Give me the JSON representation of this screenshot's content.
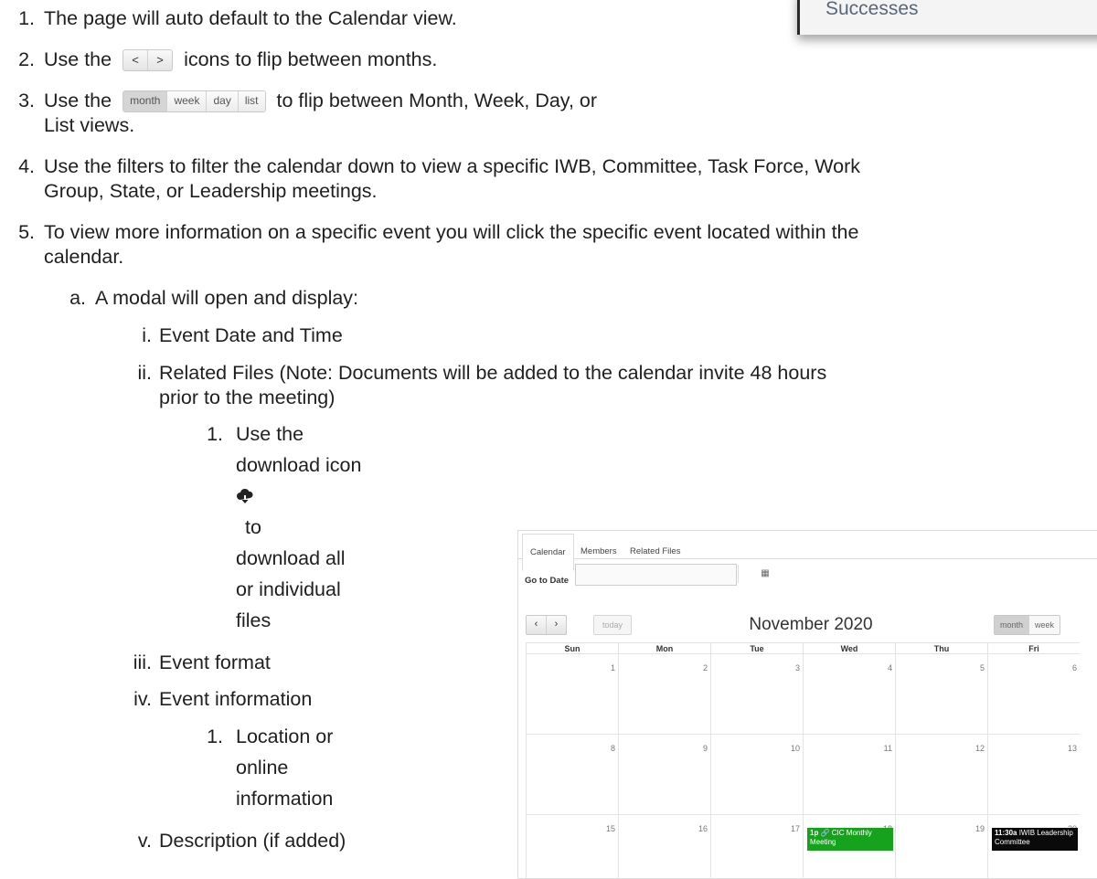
{
  "successes_label": "Successes",
  "steps": [
    {
      "num": "1.",
      "text": "The page will auto default to the Calendar view."
    },
    {
      "num": "2.",
      "pre": "Use the",
      "nav_prev": "<",
      "nav_next": ">",
      "post": "icons to flip between months."
    },
    {
      "num": "3.",
      "pre": "Use the",
      "views": [
        "month",
        "week",
        "day",
        "list"
      ],
      "post": "to flip between Month, Week, Day, or",
      "cont": "List views."
    },
    {
      "num": "4.",
      "text": "Use the filters to filter the calendar down to view a specific IWB, Committee, Task Force, Work",
      "cont": "Group, State, or Leadership meetings."
    },
    {
      "num": "5.",
      "text": "To view more information on a specific event you will click the specific event located within the",
      "cont": "calendar."
    }
  ],
  "sub_a": {
    "num": "a.",
    "text": "A modal will open and display:"
  },
  "roman": [
    {
      "num": "i.",
      "text": "Event Date and Time"
    },
    {
      "num": "ii.",
      "text": "Related Files (Note: Documents will be added to the calendar invite 48 hours",
      "cont": "prior to the meeting)"
    },
    {
      "num": "iii.",
      "text": "Event format"
    },
    {
      "num": "iv.",
      "text": "Event information"
    },
    {
      "num": "v.",
      "text": "Description (if added)"
    }
  ],
  "download_item": {
    "num": "1.",
    "lines": [
      "Use the",
      "download icon",
      "to",
      "download all",
      "or individual",
      "files"
    ],
    "icon": "cloud-download-icon"
  },
  "location_item": {
    "num": "1.",
    "lines": [
      "Location or",
      "online",
      "information"
    ]
  },
  "calendar": {
    "tabs": [
      "Calendar",
      "Members",
      "Related Files"
    ],
    "goto_label": "Go to Date",
    "goto_value": "",
    "today": "today",
    "title": "November 2020",
    "views": [
      "month",
      "week"
    ],
    "days": [
      "Sun",
      "Mon",
      "Tue",
      "Wed",
      "Thu",
      "Fri"
    ],
    "weeks": [
      [
        "1",
        "2",
        "3",
        "4",
        "5",
        "6"
      ],
      [
        "8",
        "9",
        "10",
        "11",
        "12",
        "13"
      ],
      [
        "15",
        "16",
        "17",
        "18",
        "19",
        "20"
      ]
    ],
    "events": [
      {
        "time": "1p",
        "title": "CIC Monthly Meeting",
        "color": "#17a21d"
      },
      {
        "time": "11:30a",
        "title": "IWIB Leadership Committee",
        "color": "#0a0a0a"
      }
    ]
  }
}
